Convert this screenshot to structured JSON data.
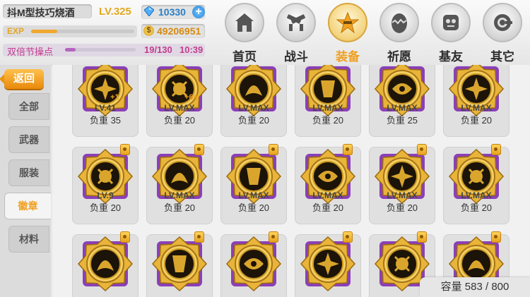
{
  "player": {
    "name": "抖M型技巧烧酒",
    "level": "LV.325",
    "gems": "10330",
    "coins": "49206951",
    "exp_label": "EXP",
    "exp_fill": 0.25
  },
  "event": {
    "label": "双倍节操点",
    "progress": "19/130",
    "time": "10:39",
    "fill": 0.15
  },
  "nav": [
    {
      "label": "首页",
      "icon": "house-icon"
    },
    {
      "label": "战斗",
      "icon": "crossed-guns-icon"
    },
    {
      "label": "装备",
      "icon": "star-gun-icon",
      "active": true
    },
    {
      "label": "祈愿",
      "icon": "egg-icon"
    },
    {
      "label": "基友",
      "icon": "friend-face-icon"
    },
    {
      "label": "其它",
      "icon": "gear-icon"
    }
  ],
  "sidebar": {
    "back": "返回",
    "tabs": [
      {
        "label": "全部"
      },
      {
        "label": "武器"
      },
      {
        "label": "服装"
      },
      {
        "label": "徽章",
        "active": true
      },
      {
        "label": "材料"
      }
    ]
  },
  "items": [
    {
      "lv": "LV.41",
      "weight": "负重 35",
      "bonus": "+1"
    },
    {
      "lv": "LV.MAX",
      "weight": "负重 20",
      "bonus": "+64"
    },
    {
      "lv": "LV.MAX",
      "weight": "负重 20"
    },
    {
      "lv": "LV.MAX",
      "weight": "负重 20"
    },
    {
      "lv": "LV.MAX",
      "weight": "负重 25"
    },
    {
      "lv": "LV.MAX",
      "weight": "负重 20"
    },
    {
      "lv": "LV.9",
      "weight": "负重 20",
      "locked": true
    },
    {
      "lv": "LV.MAX",
      "weight": "负重 20",
      "locked": true
    },
    {
      "lv": "LV.MAX",
      "weight": "负重 20",
      "locked": true
    },
    {
      "lv": "LV.MAX",
      "weight": "负重 20",
      "locked": true
    },
    {
      "lv": "LV.MAX",
      "weight": "负重 20",
      "locked": true
    },
    {
      "lv": "LV.MAX",
      "weight": "负重 20",
      "locked": true
    },
    {
      "lv": "",
      "weight": "",
      "locked": true
    },
    {
      "lv": "",
      "weight": "",
      "locked": true
    },
    {
      "lv": "",
      "weight": "",
      "locked": true
    },
    {
      "lv": "",
      "weight": "",
      "locked": true
    },
    {
      "lv": "",
      "weight": "",
      "locked": true
    },
    {
      "lv": "",
      "weight": "",
      "locked": true
    }
  ],
  "capacity": "容量 583 / 800",
  "colors": {
    "accent": "#f0a020",
    "gem": "#2a7fc7",
    "event": "#c23c8e",
    "badge_purple": "#8b3fb7"
  }
}
